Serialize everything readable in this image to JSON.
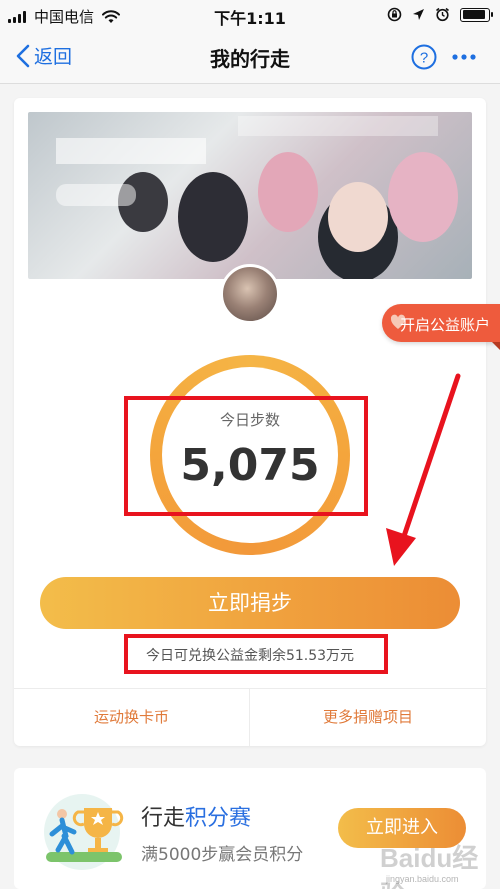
{
  "status_bar": {
    "carrier": "中国电信",
    "time": "下午1:11",
    "battery_level": 0.9
  },
  "nav": {
    "back_label": "返回",
    "title": "我的行走",
    "help_icon": "question-circle-icon",
    "more_icon": "more-dots-icon"
  },
  "ribbon": {
    "label": "开启公益账户"
  },
  "steps": {
    "label": "今日步数",
    "value": "5,075"
  },
  "donate": {
    "button_label": "立即捐步",
    "remaining_text": "今日可兑换公益金剩余51.53万元"
  },
  "links": {
    "left": "运动换卡币",
    "right": "更多捐赠项目"
  },
  "contest": {
    "title_prefix": "行走",
    "title_accent": "积分赛",
    "subtitle": "满5000步赢会员积分",
    "button_label": "立即进入"
  },
  "watermark": {
    "main": "Baidu经验",
    "sub": "jingyan.baidu.com"
  },
  "colors": {
    "accent_blue": "#1e6fe0",
    "orange": "#f0a23e",
    "highlight_red": "#e8131e"
  }
}
